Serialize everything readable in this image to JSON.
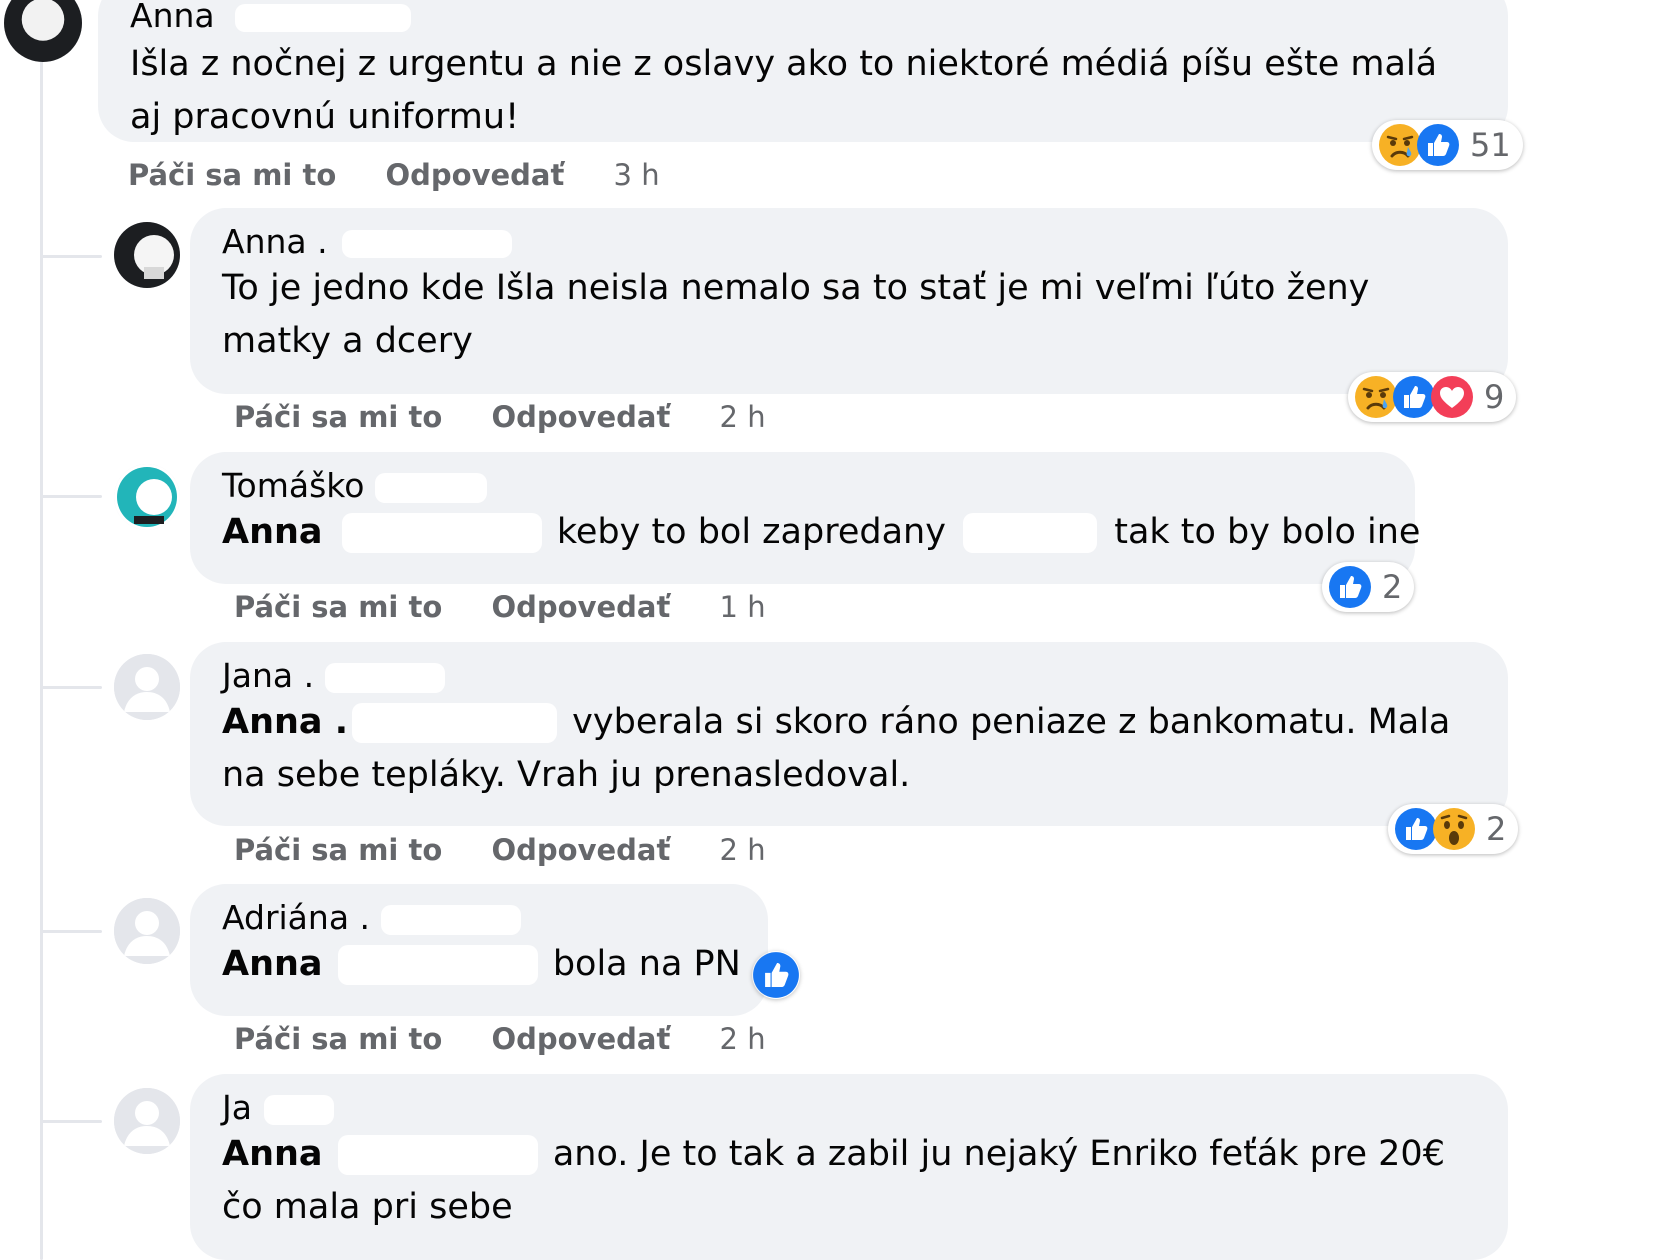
{
  "actions": {
    "like": "Páči sa mi to",
    "reply": "Odpovedať"
  },
  "colors": {
    "like_blue": "#1877f2",
    "love_red": "#f33e58",
    "bubble": "#f0f2f5",
    "meta_gray": "#65676b"
  },
  "comments": [
    {
      "author": "Anna",
      "text": "Išla z nočnej z urgentu a nie z oslavy ako to niektoré médiá píšu ešte malá aj pracovnú uniformu!",
      "time": "3 h",
      "reactions": {
        "icons": [
          "sad-icon",
          "like-icon"
        ],
        "count": "51"
      }
    },
    {
      "author": "Anna .",
      "text": "To je jedno kde Išla neisla nemalo sa to stať je mi veľmi ľúto ženy matky a dcery",
      "time": "2 h",
      "reactions": {
        "icons": [
          "sad-icon",
          "like-icon",
          "love-icon"
        ],
        "count": "9"
      }
    },
    {
      "author": "Tomáško",
      "tag": "Anna",
      "text_part1": "keby to bol zapredany",
      "text_part2": "tak to by bolo ine",
      "time": "1 h",
      "reactions": {
        "icons": [
          "like-icon"
        ],
        "count": "2"
      }
    },
    {
      "author": "Jana .",
      "tag": "Anna .",
      "text": "vyberala si skoro ráno peniaze z bankomatu. Mala na sebe tepláky. Vrah ju prenasledoval.",
      "time": "2 h",
      "reactions": {
        "icons": [
          "like-icon",
          "wow-icon"
        ],
        "count": "2"
      }
    },
    {
      "author": "Adriána .",
      "tag": "Anna",
      "text": "bola na PN",
      "time": "2 h",
      "reactions": {
        "icons": [
          "like-icon"
        ]
      }
    },
    {
      "author": "Ja",
      "tag": "Anna",
      "text": "ano. Je to tak a zabil ju nejaký Enriko feťák pre 20€ čo mala pri sebe"
    }
  ]
}
